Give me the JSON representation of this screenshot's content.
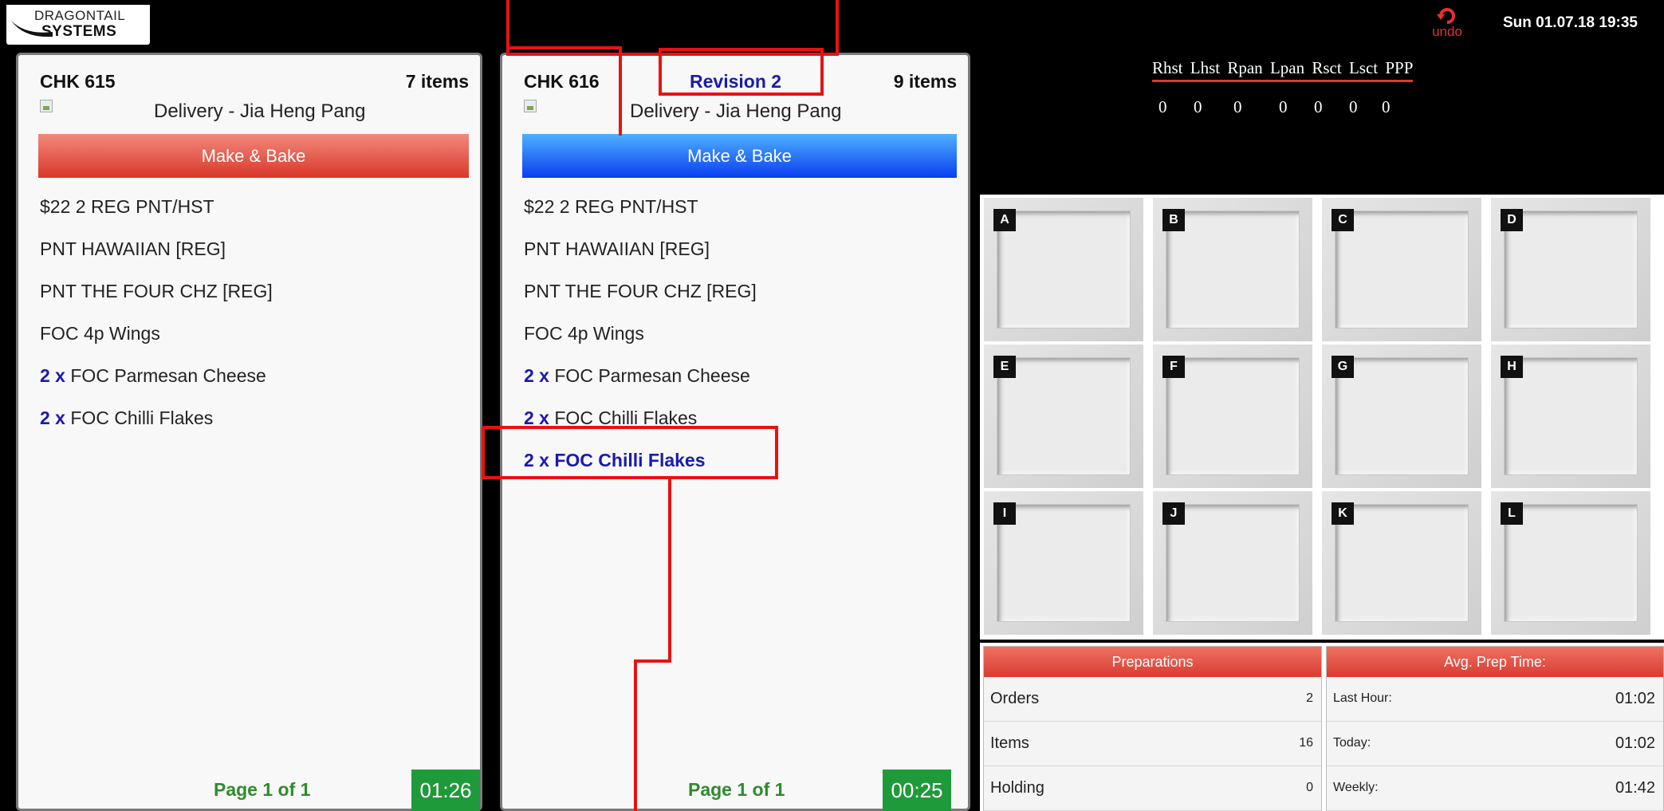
{
  "header": {
    "logo_line1": "DRAGONTAIL",
    "logo_line2": "SYSTEMS",
    "undo_label": "undo",
    "datetime": "Sun 01.07.18 19:35"
  },
  "checks": [
    {
      "title": "CHK 615",
      "item_count": "7 items",
      "customer": "Delivery - Jia Heng Pang",
      "type": "Make & Bake",
      "items": [
        {
          "qty": "",
          "name": "$22 2 REG PNT/HST"
        },
        {
          "qty": "",
          "name": "PNT HAWAIIAN [REG]"
        },
        {
          "qty": "",
          "name": "PNT THE FOUR CHZ [REG]"
        },
        {
          "qty": "",
          "name": "FOC 4p Wings"
        },
        {
          "qty": "2 x",
          "name": "FOC Parmesan Cheese"
        },
        {
          "qty": "2 x",
          "name": "FOC Chilli Flakes"
        }
      ],
      "page": "Page 1 of 1",
      "timer": "01:26"
    },
    {
      "title": "CHK 616",
      "revision": "Revision 2",
      "item_count": "9 items",
      "customer": "Delivery - Jia Heng Pang",
      "type": "Make & Bake",
      "items": [
        {
          "qty": "",
          "name": "$22 2 REG PNT/HST"
        },
        {
          "qty": "",
          "name": "PNT HAWAIIAN [REG]"
        },
        {
          "qty": "",
          "name": "PNT THE FOUR CHZ [REG]"
        },
        {
          "qty": "",
          "name": "FOC 4p Wings"
        },
        {
          "qty": "2 x",
          "name": "FOC Parmesan Cheese"
        },
        {
          "qty": "2 x",
          "name": "FOC Chilli Flakes"
        }
      ],
      "revised_item": "2 x FOC Chilli Flakes",
      "page": "Page 1 of 1",
      "timer": "00:25"
    }
  ],
  "station_counts": {
    "headers": [
      "Rhst",
      "Lhst",
      "Rpan",
      "Lpan",
      "Rsct",
      "Lsct",
      "PPP"
    ],
    "values": [
      "0",
      "0",
      "0",
      "0",
      "0",
      "0",
      "0"
    ]
  },
  "slots": [
    "A",
    "B",
    "C",
    "D",
    "E",
    "F",
    "G",
    "H",
    "I",
    "J",
    "K",
    "L"
  ],
  "stats": {
    "preparations": {
      "title": "Preparations",
      "rows": [
        {
          "label": "Orders",
          "value": "2"
        },
        {
          "label": "Items",
          "value": "16"
        },
        {
          "label": "Holding",
          "value": "0"
        }
      ]
    },
    "avg_prep": {
      "title": "Avg. Prep Time:",
      "rows": [
        {
          "label": "Last Hour:",
          "value": "01:02"
        },
        {
          "label": "Today:",
          "value": "01:02"
        },
        {
          "label": "Weekly:",
          "value": "01:42"
        }
      ]
    }
  },
  "colors": {
    "make_bake_old": "#d9382b",
    "make_bake_revised": "#0a3ef0",
    "revision_text": "#1a1ab0",
    "timer": "#1f9a3a",
    "annotation": "#e81212"
  }
}
